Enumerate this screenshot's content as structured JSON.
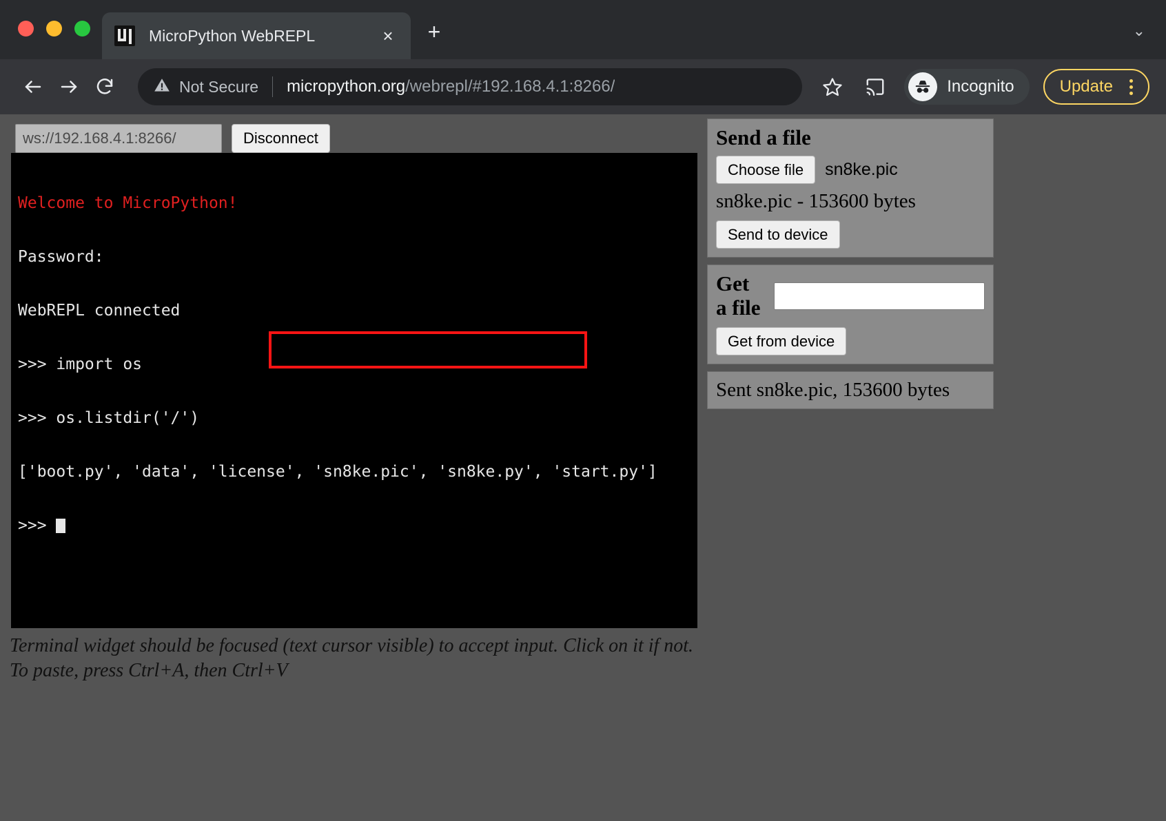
{
  "browser": {
    "tab": {
      "title": "MicroPython WebREPL",
      "favicon_name": "micropython-logo-icon",
      "close_label": "×"
    },
    "new_tab_label": "+",
    "tabstrip_caret": "⌄",
    "toolbar": {
      "back_label": "←",
      "forward_label": "→",
      "reload_label": "↻",
      "security_text": "Not Secure",
      "url_host": "micropython.org",
      "url_path": "/webrepl/#192.168.4.1:8266/",
      "full_url": "micropython.org/webrepl/#192.168.4.1:8266/",
      "incognito_label": "Incognito",
      "update_label": "Update"
    },
    "colors": {
      "tabstrip_bg": "#292b2e",
      "toolbar_bg": "#35363a",
      "omnibox_bg": "#202124",
      "active_tab_bg": "#3c4043",
      "update_accent": "#fdd663",
      "traffic_red": "#ff5f57",
      "traffic_yellow": "#febc2e",
      "traffic_green": "#28c840"
    }
  },
  "page": {
    "background_color": "#545454",
    "connection": {
      "url_value": "ws://192.168.4.1:8266/",
      "url_placeholder": "ws://192.168.4.1:8266/",
      "disconnect_label": "Disconnect"
    },
    "terminal": {
      "background_color": "#000000",
      "text_color": "#e6e6e6",
      "welcome_color": "#e02020",
      "lines": [
        "Welcome to MicroPython!",
        "Password:",
        "WebREPL connected",
        ">>> import os",
        ">>> os.listdir('/')",
        "['boot.py', 'data', 'license', 'sn8ke.pic', 'sn8ke.py', 'start.py']",
        ">>> "
      ],
      "welcome_line": "Welcome to MicroPython!",
      "line_password": "Password:",
      "line_connected": "WebREPL connected",
      "line_import": ">>> import os",
      "line_listdir": ">>> os.listdir('/')",
      "line_result_prefix": "['boot.py', 'data', 'license',",
      "line_result_highlighted": " 'sn8ke.pic', 'sn8ke.py', 'start.py']",
      "line_prompt": ">>> "
    },
    "annotation": {
      "name": "red-highlight-box",
      "color": "#f81414",
      "targets": "'sn8ke.pic', 'sn8ke.py', 'start.py']"
    },
    "footer_note_line1": "Terminal widget should be focused (text cursor visible) to accept input. Click on it if not.",
    "footer_note_line2": "To paste, press Ctrl+A, then Ctrl+V",
    "send_panel": {
      "title": "Send a file",
      "choose_file_label": "Choose file",
      "chosen_file_name": "sn8ke.pic",
      "file_info": "sn8ke.pic - 153600 bytes",
      "send_label": "Send to device"
    },
    "get_panel": {
      "title": "Get a file",
      "filename_value": "",
      "filename_placeholder": "",
      "get_label": "Get from device"
    },
    "status": {
      "text": "Sent sn8ke.pic, 153600 bytes"
    }
  }
}
